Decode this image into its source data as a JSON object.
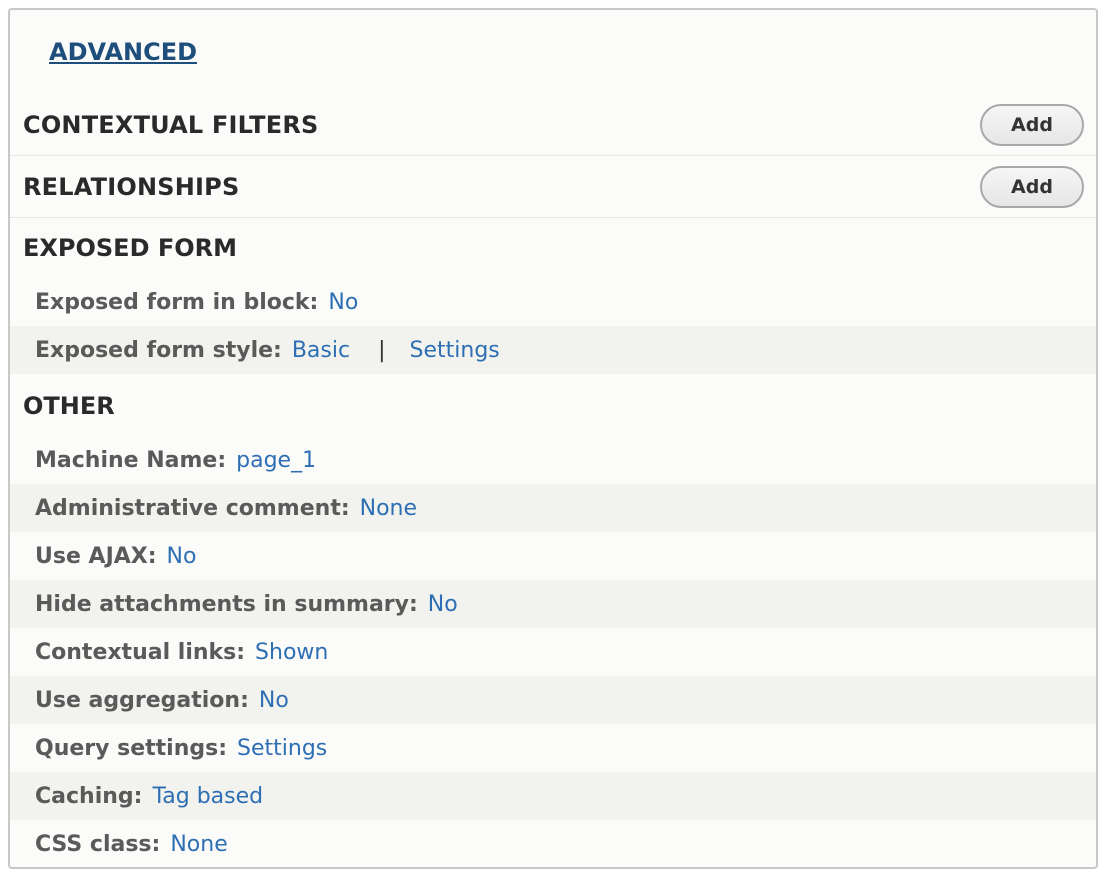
{
  "advanced_link": "ADVANCED",
  "contextual_filters": {
    "title": "CONTEXTUAL FILTERS",
    "add_label": "Add"
  },
  "relationships": {
    "title": "RELATIONSHIPS",
    "add_label": "Add"
  },
  "exposed_form": {
    "title": "EXPOSED FORM",
    "rows": [
      {
        "label": "Exposed form in block:",
        "value": "No"
      },
      {
        "label": "Exposed form style:",
        "value": "Basic",
        "separator": "|",
        "extra": "Settings"
      }
    ]
  },
  "other": {
    "title": "OTHER",
    "rows": [
      {
        "label": "Machine Name:",
        "value": "page_1"
      },
      {
        "label": "Administrative comment:",
        "value": "None"
      },
      {
        "label": "Use AJAX:",
        "value": "No"
      },
      {
        "label": "Hide attachments in summary:",
        "value": "No"
      },
      {
        "label": "Contextual links:",
        "value": "Shown"
      },
      {
        "label": "Use aggregation:",
        "value": "No"
      },
      {
        "label": "Query settings:",
        "value": "Settings"
      },
      {
        "label": "Caching:",
        "value": "Tag based"
      },
      {
        "label": "CSS class:",
        "value": "None"
      }
    ]
  },
  "colors": {
    "link": "#2e6fb4",
    "heading": "#2a2a2a",
    "label": "#5a5a5a",
    "stripe": "#f2f3ef"
  }
}
